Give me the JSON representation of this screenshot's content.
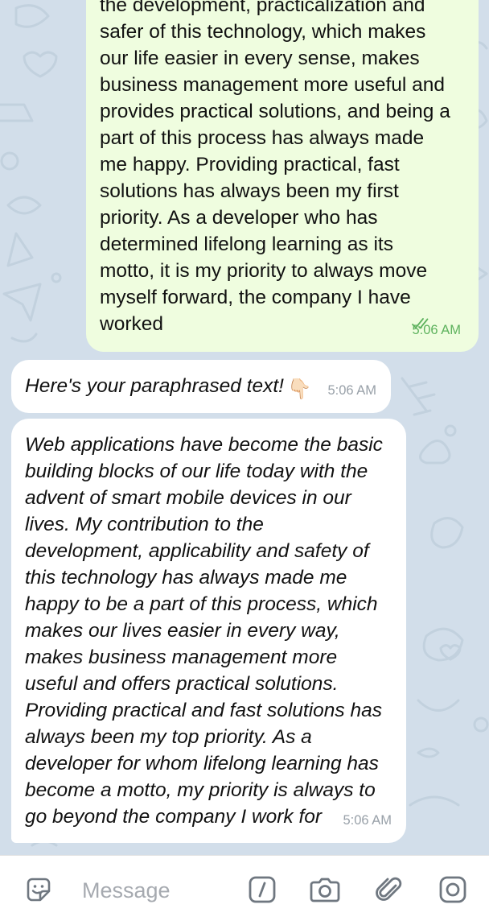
{
  "chat": {
    "messages": [
      {
        "direction": "outgoing",
        "text": "the development, practicalization and\nsafer of this technology, which makes\nour life easier in every sense, makes\nbusiness management more useful and\nprovides practical solutions, and being a\npart of this process has always made\nme happy. Providing practical, fast\nsolutions has always been my first\npriority. As a developer who has\ndetermined lifelong learning as its\nmotto, it is my priority to always move\nmyself forward, the company I have\nworked",
        "time": "5:06 AM",
        "status_icon": "double-check-icon"
      },
      {
        "direction": "incoming",
        "text": "Here's your paraphrased text!",
        "emoji": "👇🏻",
        "time": "5:06 AM"
      },
      {
        "direction": "incoming",
        "text": "Web applications have become the basic\nbuilding blocks of our life today with the\nadvent of smart mobile devices in our\nlives. My contribution to the\ndevelopment, applicability and safety of\nthis technology has always made me\nhappy to be a part of this process, which\nmakes our lives easier in every way,\nmakes business management more\nuseful and offers practical solutions.\nProviding practical and fast solutions has\nalways been my top priority. As a\ndeveloper for whom lifelong learning has\nbecome a motto, my priority is always to\ngo beyond the company I work for",
        "time": "5:06 AM"
      }
    ]
  },
  "input_bar": {
    "placeholder": "Message",
    "icons": [
      "emoji-icon",
      "bot-command-icon",
      "camera-icon",
      "attach-icon",
      "instagram-camera-icon"
    ]
  },
  "colors": {
    "chat_background": "#d2deea",
    "outgoing_bubble": "#effddf",
    "incoming_bubble": "#ffffff",
    "outgoing_meta": "#5eb25e",
    "incoming_meta": "#98a0a8",
    "icon_gray": "#6f7780"
  }
}
